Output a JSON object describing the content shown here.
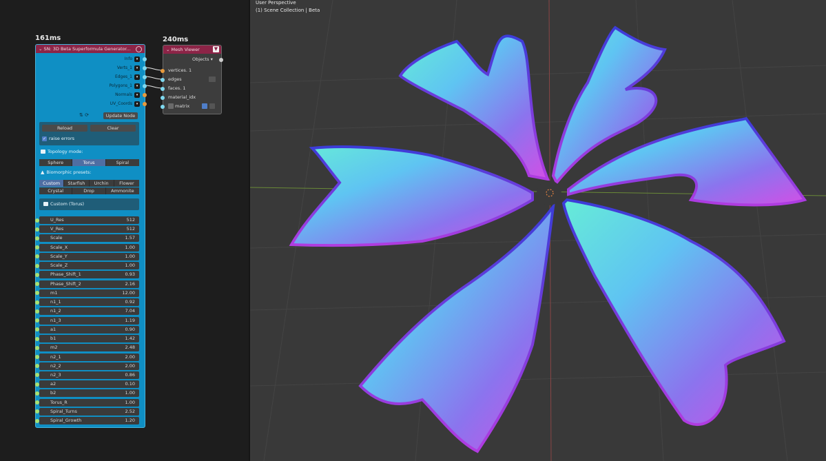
{
  "node_editor": {
    "gen_timing": "161ms",
    "viewer_timing": "240ms",
    "generator": {
      "title": "SN: 3D Beta Superformula Generator...",
      "outputs": [
        "Info",
        "Verts_1",
        "Edges_1",
        "Polygons_1",
        "Normals",
        "UV_Coords"
      ],
      "update_label": "Update Node",
      "reload_label": "Reload",
      "clear_label": "Clear",
      "raise_errors_label": "raise errors",
      "topology_label": "Topology mode:",
      "topology_tabs": [
        "Sphere",
        "Torus",
        "Spiral"
      ],
      "topology_active": "Torus",
      "presets_label": "Biomorphic presets:",
      "presets_row1": [
        "Custom",
        "Starfish",
        "Urchin",
        "Flower"
      ],
      "presets_row2": [
        "Crystal",
        "Drop",
        "Ammonite"
      ],
      "preset_active": "Custom",
      "preset_status": "Custom (Torus)",
      "properties": [
        {
          "label": "U_Res",
          "value": "512"
        },
        {
          "label": "V_Res",
          "value": "512"
        },
        {
          "label": "Scale",
          "value": "1.57"
        },
        {
          "label": "Scale_X",
          "value": "1.00"
        },
        {
          "label": "Scale_Y",
          "value": "1.00"
        },
        {
          "label": "Scale_Z",
          "value": "1.00"
        },
        {
          "label": "Phase_Shift_1",
          "value": "0.93"
        },
        {
          "label": "Phase_Shift_2",
          "value": "2.16"
        },
        {
          "label": "m1",
          "value": "12.00"
        },
        {
          "label": "n1_1",
          "value": "0.92"
        },
        {
          "label": "n1_2",
          "value": "7.04"
        },
        {
          "label": "n1_3",
          "value": "1.19"
        },
        {
          "label": "a1",
          "value": "0.90"
        },
        {
          "label": "b1",
          "value": "1.42"
        },
        {
          "label": "m2",
          "value": "2.48"
        },
        {
          "label": "n2_1",
          "value": "2.00"
        },
        {
          "label": "n2_2",
          "value": "2.00"
        },
        {
          "label": "n2_3",
          "value": "0.86"
        },
        {
          "label": "a2",
          "value": "0.10"
        },
        {
          "label": "b2",
          "value": "1.00"
        },
        {
          "label": "Torus_R",
          "value": "1.00"
        },
        {
          "label": "Spiral_Turns",
          "value": "2.52"
        },
        {
          "label": "Spiral_Growth",
          "value": "1.20"
        }
      ]
    },
    "mesh_viewer": {
      "title": "Mesh Viewer",
      "objects_label": "Objects",
      "inputs": [
        "vertices. 1",
        "edges",
        "faces. 1",
        "material_idx",
        "matrix"
      ]
    }
  },
  "viewport": {
    "perspective_label": "User Perspective",
    "collection_label": "(1) Scene Collection | Beta",
    "colors": {
      "background": "#393939",
      "x_axis": "#8a4646",
      "y_axis": "#6a8a38",
      "grid": "#444444"
    }
  }
}
